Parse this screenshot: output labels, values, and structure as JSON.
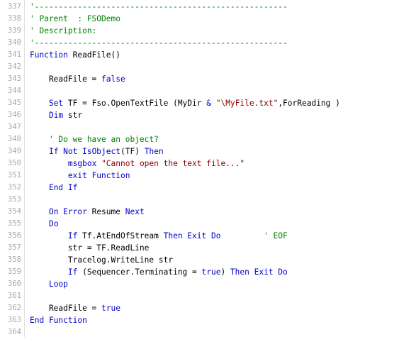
{
  "lines": [
    {
      "n": "337",
      "tokens": [
        {
          "t": "'-----------------------------------------------------",
          "c": "cm"
        }
      ]
    },
    {
      "n": "338",
      "tokens": [
        {
          "t": "' Parent  : FSODemo",
          "c": "cm"
        }
      ]
    },
    {
      "n": "339",
      "tokens": [
        {
          "t": "' Description:",
          "c": "cm"
        }
      ]
    },
    {
      "n": "340",
      "tokens": [
        {
          "t": "'-----------------------------------------------------",
          "c": "cm"
        }
      ]
    },
    {
      "n": "341",
      "tokens": [
        {
          "t": "Function",
          "c": "kw"
        },
        {
          "t": " ReadFile()",
          "c": "pl"
        }
      ]
    },
    {
      "n": "342",
      "tokens": []
    },
    {
      "n": "343",
      "tokens": [
        {
          "t": "    ReadFile = ",
          "c": "pl"
        },
        {
          "t": "false",
          "c": "kw"
        }
      ]
    },
    {
      "n": "344",
      "tokens": []
    },
    {
      "n": "345",
      "tokens": [
        {
          "t": "    ",
          "c": "pl"
        },
        {
          "t": "Set",
          "c": "kw"
        },
        {
          "t": " TF = Fso.OpenTextFile (MyDir ",
          "c": "pl"
        },
        {
          "t": "&",
          "c": "kw"
        },
        {
          "t": " ",
          "c": "pl"
        },
        {
          "t": "\"\\MyFile.txt\"",
          "c": "st"
        },
        {
          "t": ",ForReading )",
          "c": "pl"
        }
      ]
    },
    {
      "n": "346",
      "tokens": [
        {
          "t": "    ",
          "c": "pl"
        },
        {
          "t": "Dim",
          "c": "kw"
        },
        {
          "t": " str",
          "c": "pl"
        }
      ]
    },
    {
      "n": "347",
      "tokens": []
    },
    {
      "n": "348",
      "tokens": [
        {
          "t": "    ' Do we have an object?",
          "c": "cm"
        }
      ]
    },
    {
      "n": "349",
      "tokens": [
        {
          "t": "    ",
          "c": "pl"
        },
        {
          "t": "If Not IsObject",
          "c": "kw"
        },
        {
          "t": "(TF) ",
          "c": "pl"
        },
        {
          "t": "Then",
          "c": "kw"
        }
      ]
    },
    {
      "n": "350",
      "tokens": [
        {
          "t": "        ",
          "c": "pl"
        },
        {
          "t": "msgbox",
          "c": "kw"
        },
        {
          "t": " ",
          "c": "pl"
        },
        {
          "t": "\"Cannot open the text file...\"",
          "c": "st"
        }
      ]
    },
    {
      "n": "351",
      "tokens": [
        {
          "t": "        ",
          "c": "pl"
        },
        {
          "t": "exit Function",
          "c": "kw"
        }
      ]
    },
    {
      "n": "352",
      "tokens": [
        {
          "t": "    ",
          "c": "pl"
        },
        {
          "t": "End If",
          "c": "kw"
        }
      ]
    },
    {
      "n": "353",
      "tokens": []
    },
    {
      "n": "354",
      "tokens": [
        {
          "t": "    ",
          "c": "pl"
        },
        {
          "t": "On Error",
          "c": "kw"
        },
        {
          "t": " Resume ",
          "c": "pl"
        },
        {
          "t": "Next",
          "c": "kw"
        }
      ]
    },
    {
      "n": "355",
      "tokens": [
        {
          "t": "    ",
          "c": "pl"
        },
        {
          "t": "Do",
          "c": "kw"
        }
      ]
    },
    {
      "n": "356",
      "tokens": [
        {
          "t": "        ",
          "c": "pl"
        },
        {
          "t": "If",
          "c": "kw"
        },
        {
          "t": " Tf.AtEndOfStream ",
          "c": "pl"
        },
        {
          "t": "Then Exit Do",
          "c": "kw"
        },
        {
          "t": "         ' EOF",
          "c": "cm"
        }
      ]
    },
    {
      "n": "357",
      "tokens": [
        {
          "t": "        str = TF.ReadLine",
          "c": "pl"
        }
      ]
    },
    {
      "n": "358",
      "tokens": [
        {
          "t": "        Tracelog.WriteLine str",
          "c": "pl"
        }
      ]
    },
    {
      "n": "359",
      "tokens": [
        {
          "t": "        ",
          "c": "pl"
        },
        {
          "t": "If",
          "c": "kw"
        },
        {
          "t": " (Sequencer.Terminating = ",
          "c": "pl"
        },
        {
          "t": "true",
          "c": "kw"
        },
        {
          "t": ") ",
          "c": "pl"
        },
        {
          "t": "Then Exit Do",
          "c": "kw"
        }
      ]
    },
    {
      "n": "360",
      "tokens": [
        {
          "t": "    ",
          "c": "pl"
        },
        {
          "t": "Loop",
          "c": "kw"
        }
      ]
    },
    {
      "n": "361",
      "tokens": []
    },
    {
      "n": "362",
      "tokens": [
        {
          "t": "    ReadFile = ",
          "c": "pl"
        },
        {
          "t": "true",
          "c": "kw"
        }
      ]
    },
    {
      "n": "363",
      "tokens": [
        {
          "t": "End Function",
          "c": "kw"
        }
      ]
    },
    {
      "n": "364",
      "tokens": []
    }
  ]
}
